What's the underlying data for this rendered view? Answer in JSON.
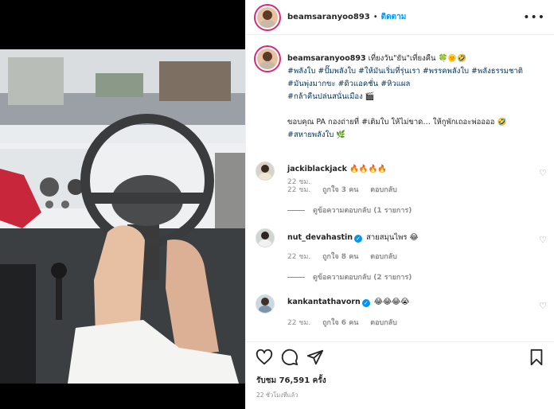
{
  "post": {
    "username": "beamsaranyoo893",
    "follow_label": "ติดตาม",
    "dot": "•",
    "more_label": "•••"
  },
  "caption": {
    "username": "beamsaranyoo893",
    "text_lead": "เที่ยงวัน\"ยัน\"เที่ยงคืน 🍀🌞🤣",
    "hashtags_line1": "#พลังใบ #ปั๊มพลังใบ #ให้มันเริ่มที่รุ่นเรา #พรรคพลังใบ #พลังธรรมชาติ",
    "hashtags_line2": "#มันพุ่งมากขะ #ดิวแอคชั่น #หิวแผล",
    "hashtags_line3": "#กล้าคืนปล่นสนั่นเมือง 🎬",
    "thanks": "ขอบคุณ PA กองถ่ายที่ #เติมใบ ให้ไม่ขาด… ให้กูพักเถอะพ่ออออ 🤣",
    "hashtag_end": "#สหายพลังใบ 🌿",
    "time": "22 ชม."
  },
  "comments": [
    {
      "username": "jackiblackjack",
      "verified": false,
      "text": "🔥🔥🔥🔥",
      "time": "22 ชม.",
      "likes": "ถูกใจ 3 คน",
      "reply_label": "ตอบกลับ",
      "replies": "ดูข้อความตอบกลับ (1 รายการ)"
    },
    {
      "username": "nut_devahastin",
      "verified": true,
      "text": "สายสมุนไพร 😂",
      "time": "22 ชม.",
      "likes": "ถูกใจ 8 คน",
      "reply_label": "ตอบกลับ",
      "replies": "ดูข้อความตอบกลับ (2 รายการ)"
    },
    {
      "username": "kankantathavorn",
      "verified": true,
      "text": "😂😂😂😭",
      "time": "22 ชม.",
      "likes": "ถูกใจ 6 คน",
      "reply_label": "ตอบกลับ",
      "replies": ""
    }
  ],
  "footer": {
    "views": "รับชม 76,591 ครั้ง",
    "ago": "22 ชั่วโมงที่แล้ว"
  },
  "icons": {
    "heart": "heart-icon",
    "comment": "comment-icon",
    "share": "share-icon",
    "save": "bookmark-icon",
    "verified": "verified-badge-icon"
  },
  "colors": {
    "link_blue": "#0095f6",
    "hashtag": "#00376b",
    "muted": "#8e8e8e"
  }
}
